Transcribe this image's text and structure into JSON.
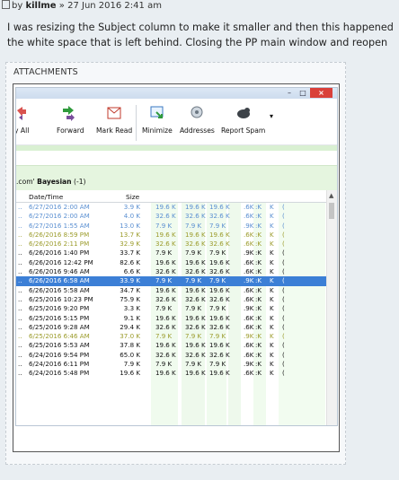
{
  "post": {
    "by_label": "by",
    "author": "killme",
    "sep": "»",
    "date": "27 Jun 2016 2:41 am",
    "body_line1": "I was resizing the Subject column to make it smaller and then this happened",
    "body_line2": "the white space that is left behind. Closing the PP main window and reopen"
  },
  "attachments": {
    "title": "ATTACHMENTS"
  },
  "window": {
    "min": "–",
    "max": "□",
    "close": "×",
    "toolbar": {
      "reply_all": "y All",
      "forward": "Forward",
      "mark_read": "Mark Read",
      "minimize": "Minimize",
      "addresses": "Addresses",
      "report_spam": "Report Spam",
      "dropdown": "▾"
    },
    "filter": {
      "prefix": ".com'",
      "folder": "Bayesian",
      "count": "(-1)"
    },
    "columns": {
      "date": "Date/Time",
      "size": "Size"
    },
    "colors": {
      "accent": "#3c7fd6",
      "green_band": "#d9f0d2",
      "blue_text": "#5a8fd1",
      "olive_text": "#9b9b2a"
    },
    "rows": [
      {
        "d": "6/27/2016 2:00 AM",
        "s": "3.9 K",
        "a": "19.6 K",
        "b": "19.6 K",
        "c": "19.6 K",
        "e": ".6K",
        "f": ":K",
        "g": "K",
        "h": "(",
        "style": "blue"
      },
      {
        "d": "6/27/2016 2:00 AM",
        "s": "4.0 K",
        "a": "32.6 K",
        "b": "32.6 K",
        "c": "32.6 K",
        "e": ".6K",
        "f": ":K",
        "g": "K",
        "h": "(",
        "style": "blue"
      },
      {
        "d": "6/27/2016 1:55 AM",
        "s": "13.0 K",
        "a": "7.9 K",
        "b": "7.9 K",
        "c": "7.9 K",
        "e": ".9K",
        "f": ":K",
        "g": "K",
        "h": "(",
        "style": "blue"
      },
      {
        "d": "6/26/2016 8:59 PM",
        "s": "13.7 K",
        "a": "19.6 K",
        "b": "19.6 K",
        "c": "19.6 K",
        "e": ".6K",
        "f": ":K",
        "g": "K",
        "h": "(",
        "style": "olive"
      },
      {
        "d": "6/26/2016 2:11 PM",
        "s": "32.9 K",
        "a": "32.6 K",
        "b": "32.6 K",
        "c": "32.6 K",
        "e": ".6K",
        "f": ":K",
        "g": "K",
        "h": "(",
        "style": "olive"
      },
      {
        "d": "6/26/2016 1:40 PM",
        "s": "33.7 K",
        "a": "7.9 K",
        "b": "7.9 K",
        "c": "7.9 K",
        "e": ".9K",
        "f": ":K",
        "g": "K",
        "h": "(",
        "style": ""
      },
      {
        "d": "6/26/2016 12:42 PM",
        "s": "82.6 K",
        "a": "19.6 K",
        "b": "19.6 K",
        "c": "19.6 K",
        "e": ".6K",
        "f": ":K",
        "g": "K",
        "h": "(",
        "style": ""
      },
      {
        "d": "6/26/2016 9:46 AM",
        "s": "6.6 K",
        "a": "32.6 K",
        "b": "32.6 K",
        "c": "32.6 K",
        "e": ".6K",
        "f": ":K",
        "g": "K",
        "h": "(",
        "style": ""
      },
      {
        "d": "6/26/2016 6:58 AM",
        "s": "33.9 K",
        "a": "7.9 K",
        "b": "7.9 K",
        "c": "7.9 K",
        "e": ".9K",
        "f": ":K",
        "g": "K",
        "h": "(",
        "style": "sel"
      },
      {
        "d": "6/26/2016 5:58 AM",
        "s": "34.7 K",
        "a": "19.6 K",
        "b": "19.6 K",
        "c": "19.6 K",
        "e": ".6K",
        "f": ":K",
        "g": "K",
        "h": "(",
        "style": ""
      },
      {
        "d": "6/25/2016 10:23 PM",
        "s": "75.9 K",
        "a": "32.6 K",
        "b": "32.6 K",
        "c": "32.6 K",
        "e": ".6K",
        "f": ":K",
        "g": "K",
        "h": "(",
        "style": ""
      },
      {
        "d": "6/25/2016 9:20 PM",
        "s": "3.3 K",
        "a": "7.9 K",
        "b": "7.9 K",
        "c": "7.9 K",
        "e": ".9K",
        "f": ":K",
        "g": "K",
        "h": "(",
        "style": ""
      },
      {
        "d": "6/25/2016 5:15 PM",
        "s": "9.1 K",
        "a": "19.6 K",
        "b": "19.6 K",
        "c": "19.6 K",
        "e": ".6K",
        "f": ":K",
        "g": "K",
        "h": "(",
        "style": ""
      },
      {
        "d": "6/25/2016 9:28 AM",
        "s": "29.4 K",
        "a": "32.6 K",
        "b": "32.6 K",
        "c": "32.6 K",
        "e": ".6K",
        "f": ":K",
        "g": "K",
        "h": "(",
        "style": ""
      },
      {
        "d": "6/25/2016 6:46 AM",
        "s": "37.0 K",
        "a": "7.9 K",
        "b": "7.9 K",
        "c": "7.9 K",
        "e": ".9K",
        "f": ":K",
        "g": "K",
        "h": "(",
        "style": "olive"
      },
      {
        "d": "6/25/2016 5:53 AM",
        "s": "37.8 K",
        "a": "19.6 K",
        "b": "19.6 K",
        "c": "19.6 K",
        "e": ".6K",
        "f": ":K",
        "g": "K",
        "h": "(",
        "style": ""
      },
      {
        "d": "6/24/2016 9:54 PM",
        "s": "65.0 K",
        "a": "32.6 K",
        "b": "32.6 K",
        "c": "32.6 K",
        "e": ".6K",
        "f": ":K",
        "g": "K",
        "h": "(",
        "style": ""
      },
      {
        "d": "6/24/2016 6:11 PM",
        "s": "7.9 K",
        "a": "7.9 K",
        "b": "7.9 K",
        "c": "7.9 K",
        "e": ".9K",
        "f": ":K",
        "g": "K",
        "h": "(",
        "style": ""
      },
      {
        "d": "6/24/2016 5:48 PM",
        "s": "19.6 K",
        "a": "19.6 K",
        "b": "19.6 K",
        "c": "19.6 K",
        "e": ".6K",
        "f": ":K",
        "g": "K",
        "h": "(",
        "style": ""
      }
    ]
  }
}
